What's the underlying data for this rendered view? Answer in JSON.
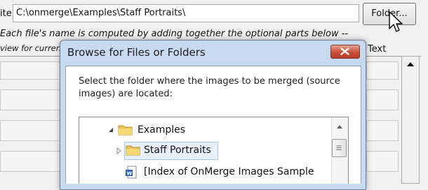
{
  "main": {
    "path_label": "ite",
    "path_value": "C:\\onmerge\\Examples\\Staff Portraits\\",
    "folder_button": "Folder...",
    "hint_line1": "Each file's name is computed by adding together the optional parts below --",
    "hint_line2": "view for current",
    "text_column_header": "Text"
  },
  "dialog": {
    "title": "Browse for Files or Folders",
    "instruction": "Select the folder where the images to be merged (source images) are located:",
    "tree": [
      {
        "label": "Examples",
        "icon": "folder-icon",
        "expanded": true
      },
      {
        "label": "Staff Portraits",
        "icon": "folder-icon",
        "expanded": false,
        "selected": true
      },
      {
        "label": "[Index of OnMerge Images Sample",
        "icon": "word-document-icon"
      }
    ]
  },
  "colors": {
    "dialog_frame": "#c7daf0",
    "close_button": "#c8503a",
    "selection": "#e8f1fb",
    "folder": "#e7c35a"
  }
}
